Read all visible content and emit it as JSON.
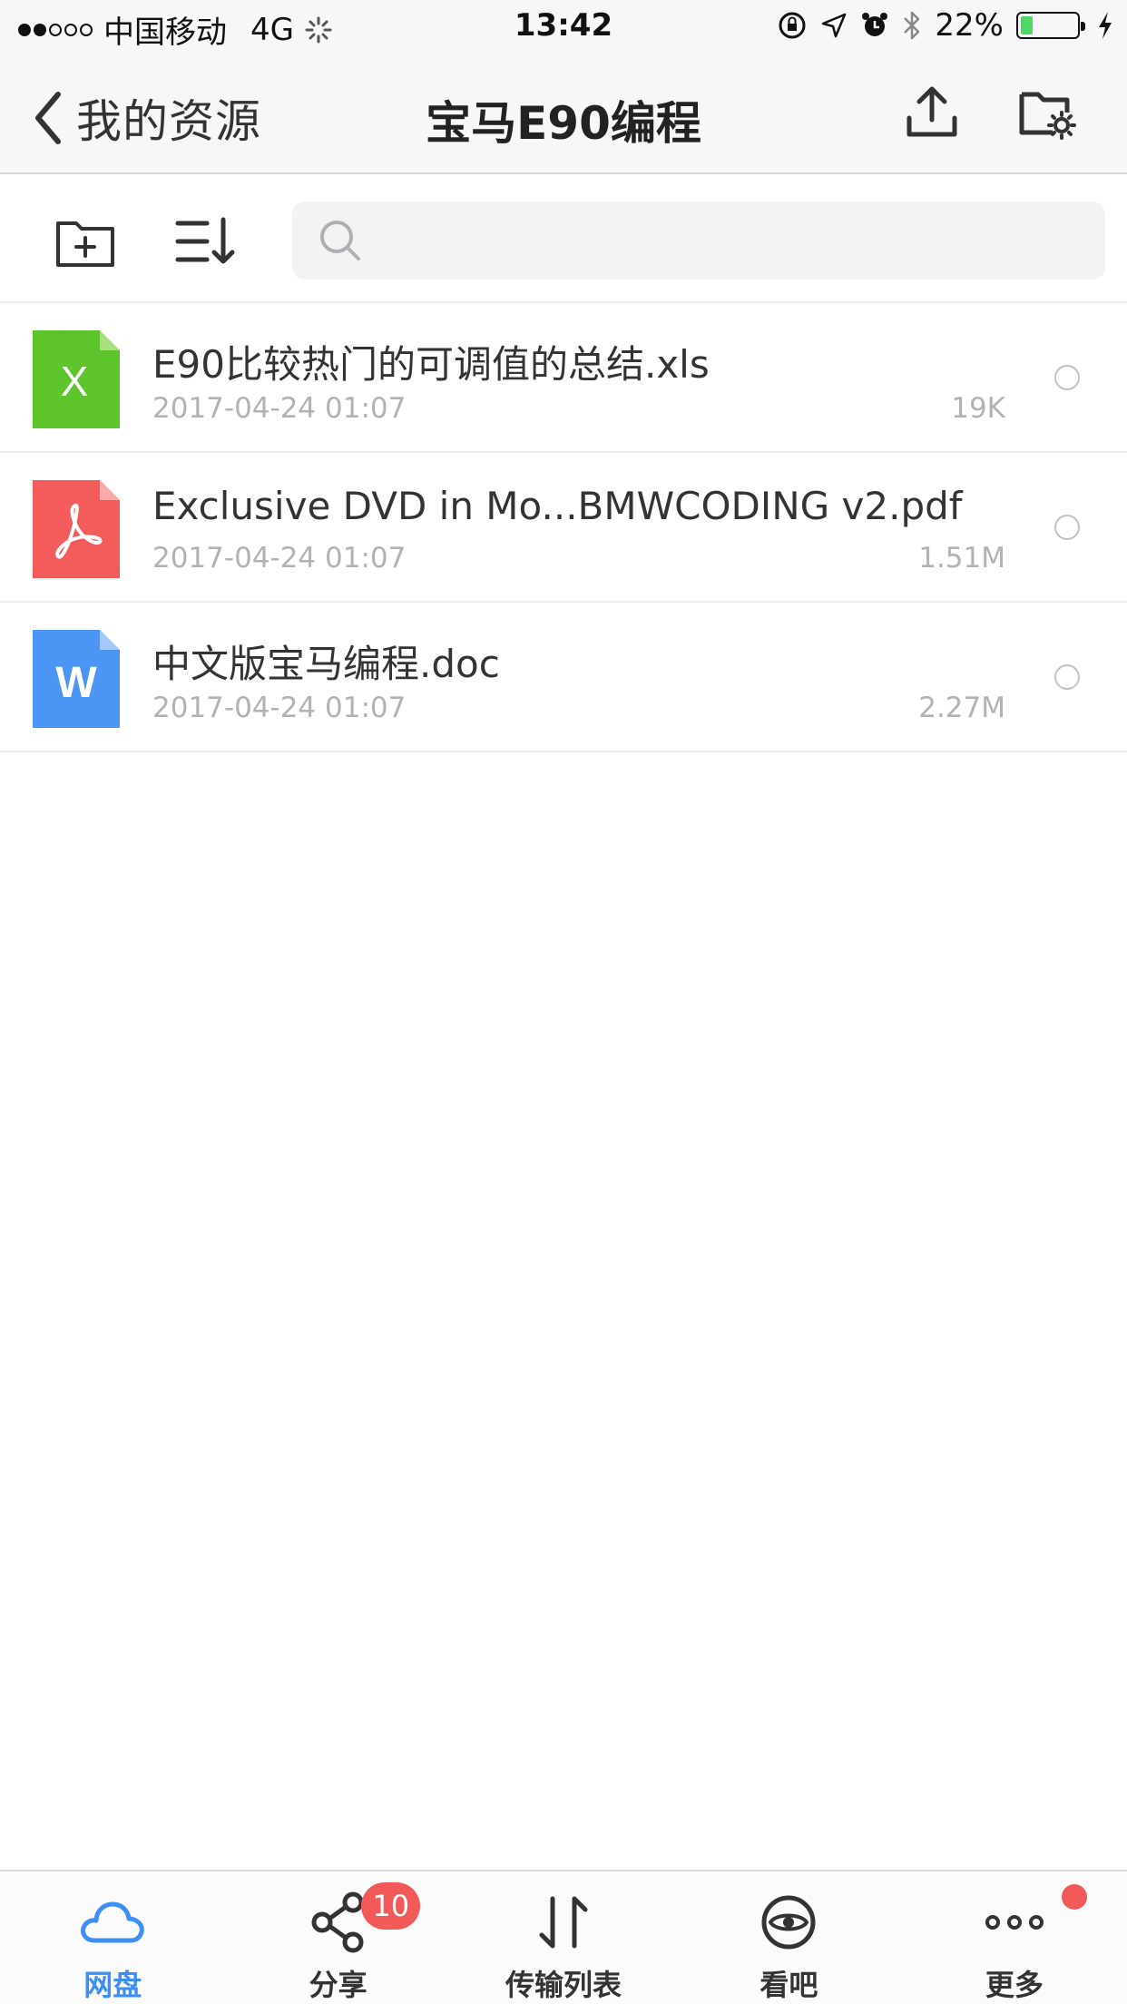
{
  "status_bar": {
    "carrier": "中国移动",
    "network": "4G",
    "time": "13:42",
    "battery": "22%",
    "battery_level": 0.22,
    "icons": [
      "orientation-lock-icon",
      "location-icon",
      "alarm-icon",
      "bluetooth-icon",
      "charging-icon"
    ]
  },
  "nav": {
    "back_label": "我的资源",
    "title": "宝马E90编程",
    "upload_icon": "upload-icon",
    "folder_settings_icon": "folder-settings-icon"
  },
  "toolbar": {
    "new_folder_icon": "new-folder-icon",
    "sort_icon": "sort-icon",
    "search_placeholder": ""
  },
  "files": [
    {
      "name": "E90比较热门的可调值的总结.xls",
      "date": "2017-04-24 01:07",
      "size": "19K",
      "type": "xls",
      "icon_letter": "X",
      "color": "#5ec42b"
    },
    {
      "name": "Exclusive DVD in Mo...BMWCODING v2.pdf",
      "date": "2017-04-24 01:07",
      "size": "1.51M",
      "type": "pdf",
      "icon_letter": "",
      "color": "#f45b5b"
    },
    {
      "name": "中文版宝马编程.doc",
      "date": "2017-04-24 01:07",
      "size": "2.27M",
      "type": "doc",
      "icon_letter": "W",
      "color": "#4b95f4"
    }
  ],
  "tabs": [
    {
      "label": "网盘",
      "icon": "cloud-icon",
      "active": true
    },
    {
      "label": "分享",
      "icon": "share-icon",
      "badge": "10"
    },
    {
      "label": "传输列表",
      "icon": "transfer-icon"
    },
    {
      "label": "看吧",
      "icon": "eye-icon"
    },
    {
      "label": "更多",
      "icon": "more-icon",
      "dot": true
    }
  ],
  "colors": {
    "accent": "#3d8ef5",
    "badge": "#f25a5a",
    "xls": "#5ec42b",
    "pdf": "#f45b5b",
    "doc": "#4b95f4"
  }
}
